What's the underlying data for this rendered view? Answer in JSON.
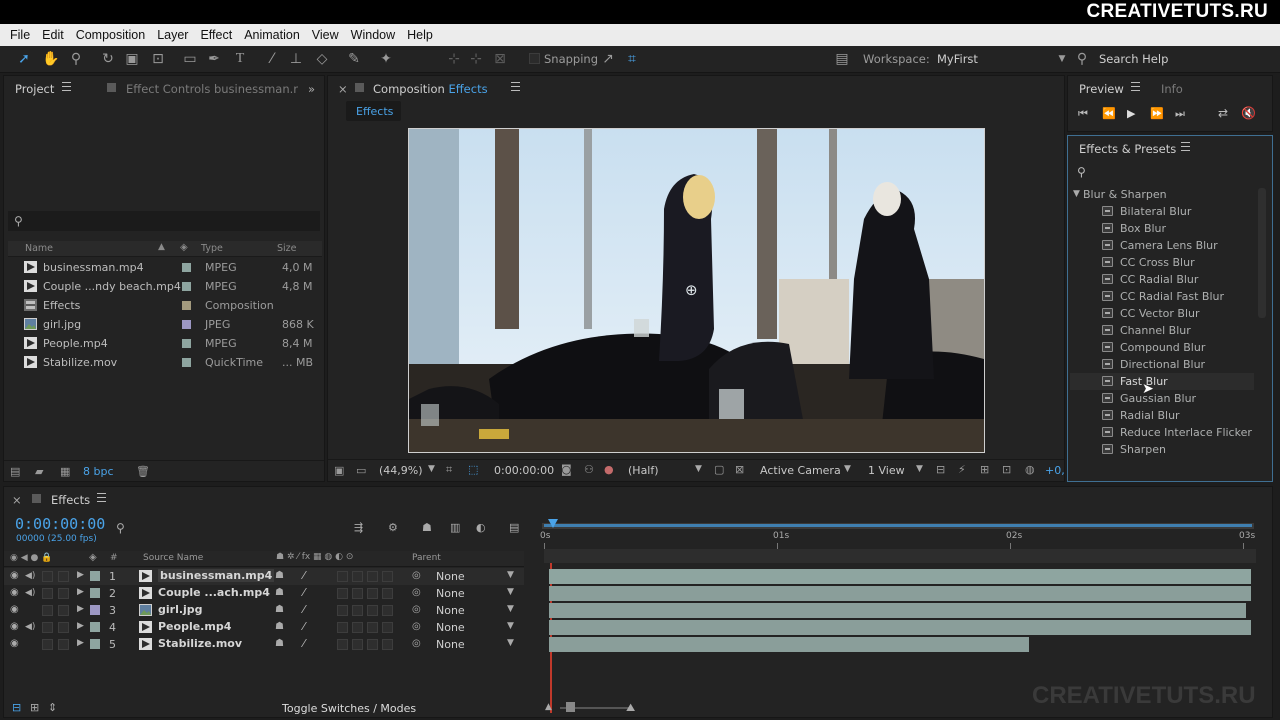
{
  "brand": "CREATIVETUTS.RU",
  "watermark": "CREATIVETUTS.RU",
  "menu": [
    "File",
    "Edit",
    "Composition",
    "Layer",
    "Effect",
    "Animation",
    "View",
    "Window",
    "Help"
  ],
  "toolbar": {
    "snapping": "Snapping",
    "workspace_label": "Workspace:",
    "workspace_value": "MyFirst",
    "search_help": "Search Help"
  },
  "project": {
    "tab": "Project",
    "effect_controls_tab": "Effect Controls businessman.r",
    "columns": {
      "name": "Name",
      "type": "Type",
      "size": "Size"
    },
    "items": [
      {
        "name": "businessman.mp4",
        "type": "MPEG",
        "size": "4,0 M",
        "icon": "video-icon",
        "color": "#8ea5a0"
      },
      {
        "name": "Couple ...ndy beach.mp4",
        "type": "MPEG",
        "size": "4,8 M",
        "icon": "video-icon",
        "color": "#8ea5a0"
      },
      {
        "name": "Effects",
        "type": "Composition",
        "size": "",
        "icon": "composition-icon",
        "color": "#a39a7e"
      },
      {
        "name": "girl.jpg",
        "type": "JPEG",
        "size": "868 K",
        "icon": "image-icon",
        "color": "#9c97c3"
      },
      {
        "name": "People.mp4",
        "type": "MPEG",
        "size": "8,4 M",
        "icon": "video-icon",
        "color": "#8ea5a0"
      },
      {
        "name": "Stabilize.mov",
        "type": "QuickTime",
        "size": "... MB",
        "icon": "video-icon",
        "color": "#8ea5a0"
      }
    ],
    "bpc": "8 bpc"
  },
  "composition": {
    "tab_prefix": "Composition",
    "tab_name": "Effects",
    "subtab": "Effects",
    "zoom": "(44,9%)",
    "timecode": "0:00:00:00",
    "resolution": "(Half)",
    "camera": "Active Camera",
    "view": "1 View",
    "offset": "+0,"
  },
  "preview": {
    "tab": "Preview",
    "info_tab": "Info"
  },
  "effects_presets": {
    "tab": "Effects & Presets",
    "category": "Blur & Sharpen",
    "items": [
      "Bilateral Blur",
      "Box Blur",
      "Camera Lens Blur",
      "CC Cross Blur",
      "CC Radial Blur",
      "CC Radial Fast Blur",
      "CC Vector Blur",
      "Channel Blur",
      "Compound Blur",
      "Directional Blur",
      "Fast Blur",
      "Gaussian Blur",
      "Radial Blur",
      "Reduce Interlace Flicker",
      "Sharpen"
    ],
    "hovered": "Fast Blur"
  },
  "timeline": {
    "tab": "Effects",
    "timecode": "0:00:00:00",
    "fps": "00000 (25.00 fps)",
    "col_source": "Source Name",
    "col_parent": "Parent",
    "col_hash": "#",
    "ruler": [
      "0s",
      "01s",
      "02s",
      "03s"
    ],
    "layers": [
      {
        "num": "1",
        "name": "businessman.mp4",
        "parent": "None",
        "audio": true,
        "color": "#8ea5a0",
        "icon": "video-icon",
        "bar_end": 0.995,
        "selected": true
      },
      {
        "num": "2",
        "name": "Couple ...ach.mp4",
        "parent": "None",
        "audio": true,
        "color": "#8ea5a0",
        "icon": "video-icon",
        "bar_end": 0.995,
        "selected": false
      },
      {
        "num": "3",
        "name": "girl.jpg",
        "parent": "None",
        "audio": false,
        "color": "#9c97c3",
        "icon": "image-icon",
        "bar_end": 0.987,
        "selected": false
      },
      {
        "num": "4",
        "name": "People.mp4",
        "parent": "None",
        "audio": true,
        "color": "#8ea5a0",
        "icon": "video-icon",
        "bar_end": 0.995,
        "selected": false
      },
      {
        "num": "5",
        "name": "Stabilize.mov",
        "parent": "None",
        "audio": false,
        "color": "#8ea5a0",
        "icon": "video-icon",
        "bar_end": 0.68,
        "selected": false
      }
    ],
    "toggle": "Toggle Switches / Modes"
  }
}
